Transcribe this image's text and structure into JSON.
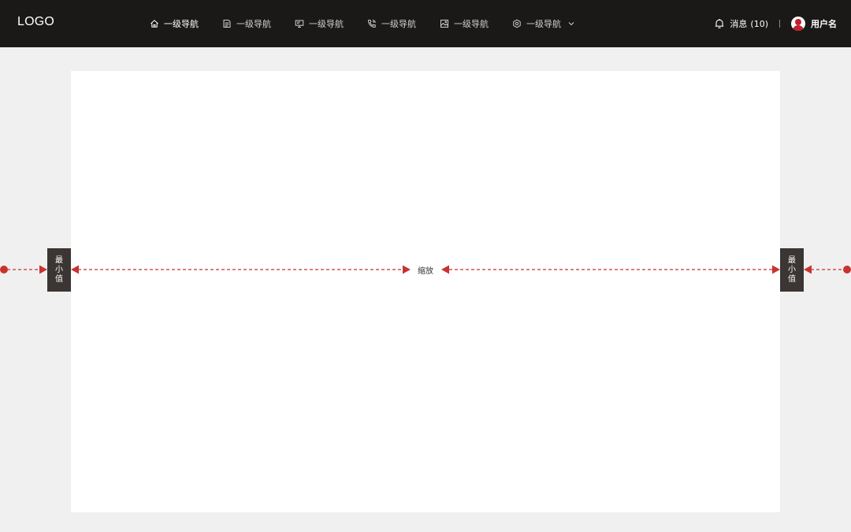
{
  "header": {
    "logo": "LOGO",
    "nav": [
      {
        "label": "一级导航",
        "icon": "home-icon",
        "active": true
      },
      {
        "label": "一级导航",
        "icon": "document-icon",
        "active": false
      },
      {
        "label": "一级导航",
        "icon": "monitor-icon",
        "active": false
      },
      {
        "label": "一级导航",
        "icon": "phone-call-icon",
        "active": false
      },
      {
        "label": "一级导航",
        "icon": "image-icon",
        "active": false
      },
      {
        "label": "一级导航",
        "icon": "settings-icon",
        "active": false,
        "has_dropdown": true
      }
    ],
    "messages_label": "消息",
    "messages_count": "(10)",
    "username": "用户名"
  },
  "annotations": {
    "left_min": [
      "最",
      "小",
      "值"
    ],
    "right_min": [
      "最",
      "小",
      "值"
    ],
    "center_label": "缩放"
  },
  "colors": {
    "header_bg": "#1b1917",
    "page_bg": "#f0f0f0",
    "panel_bg": "#ffffff",
    "annotation_red": "#c8332f",
    "min_box_bg": "#3b3533"
  }
}
